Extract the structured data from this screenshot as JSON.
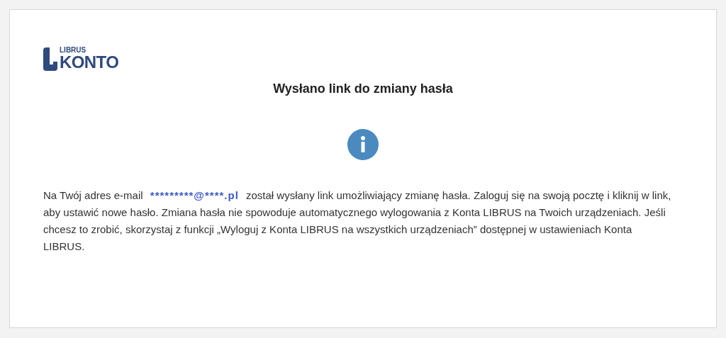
{
  "logo": {
    "brand": "LIBRUS",
    "product": "KONTO"
  },
  "title": "Wysłano link do zmiany hasła",
  "message": {
    "before": "Na Twój adres e-mail",
    "email": "*********@****.pl",
    "after": "został wysłany link umożliwiający zmianę hasła. Zaloguj się na swoją pocztę i kliknij w link, aby ustawić nowe hasło. Zmiana hasła nie spowoduje automatycznego wylogowania z Konta LIBRUS na Twoich urządzeniach. Jeśli chcesz to zrobić, skorzystaj z funkcji „Wyloguj z Konta LIBRUS na wszystkich urządzeniach” dostępnej w ustawieniach Konta LIBRUS."
  }
}
